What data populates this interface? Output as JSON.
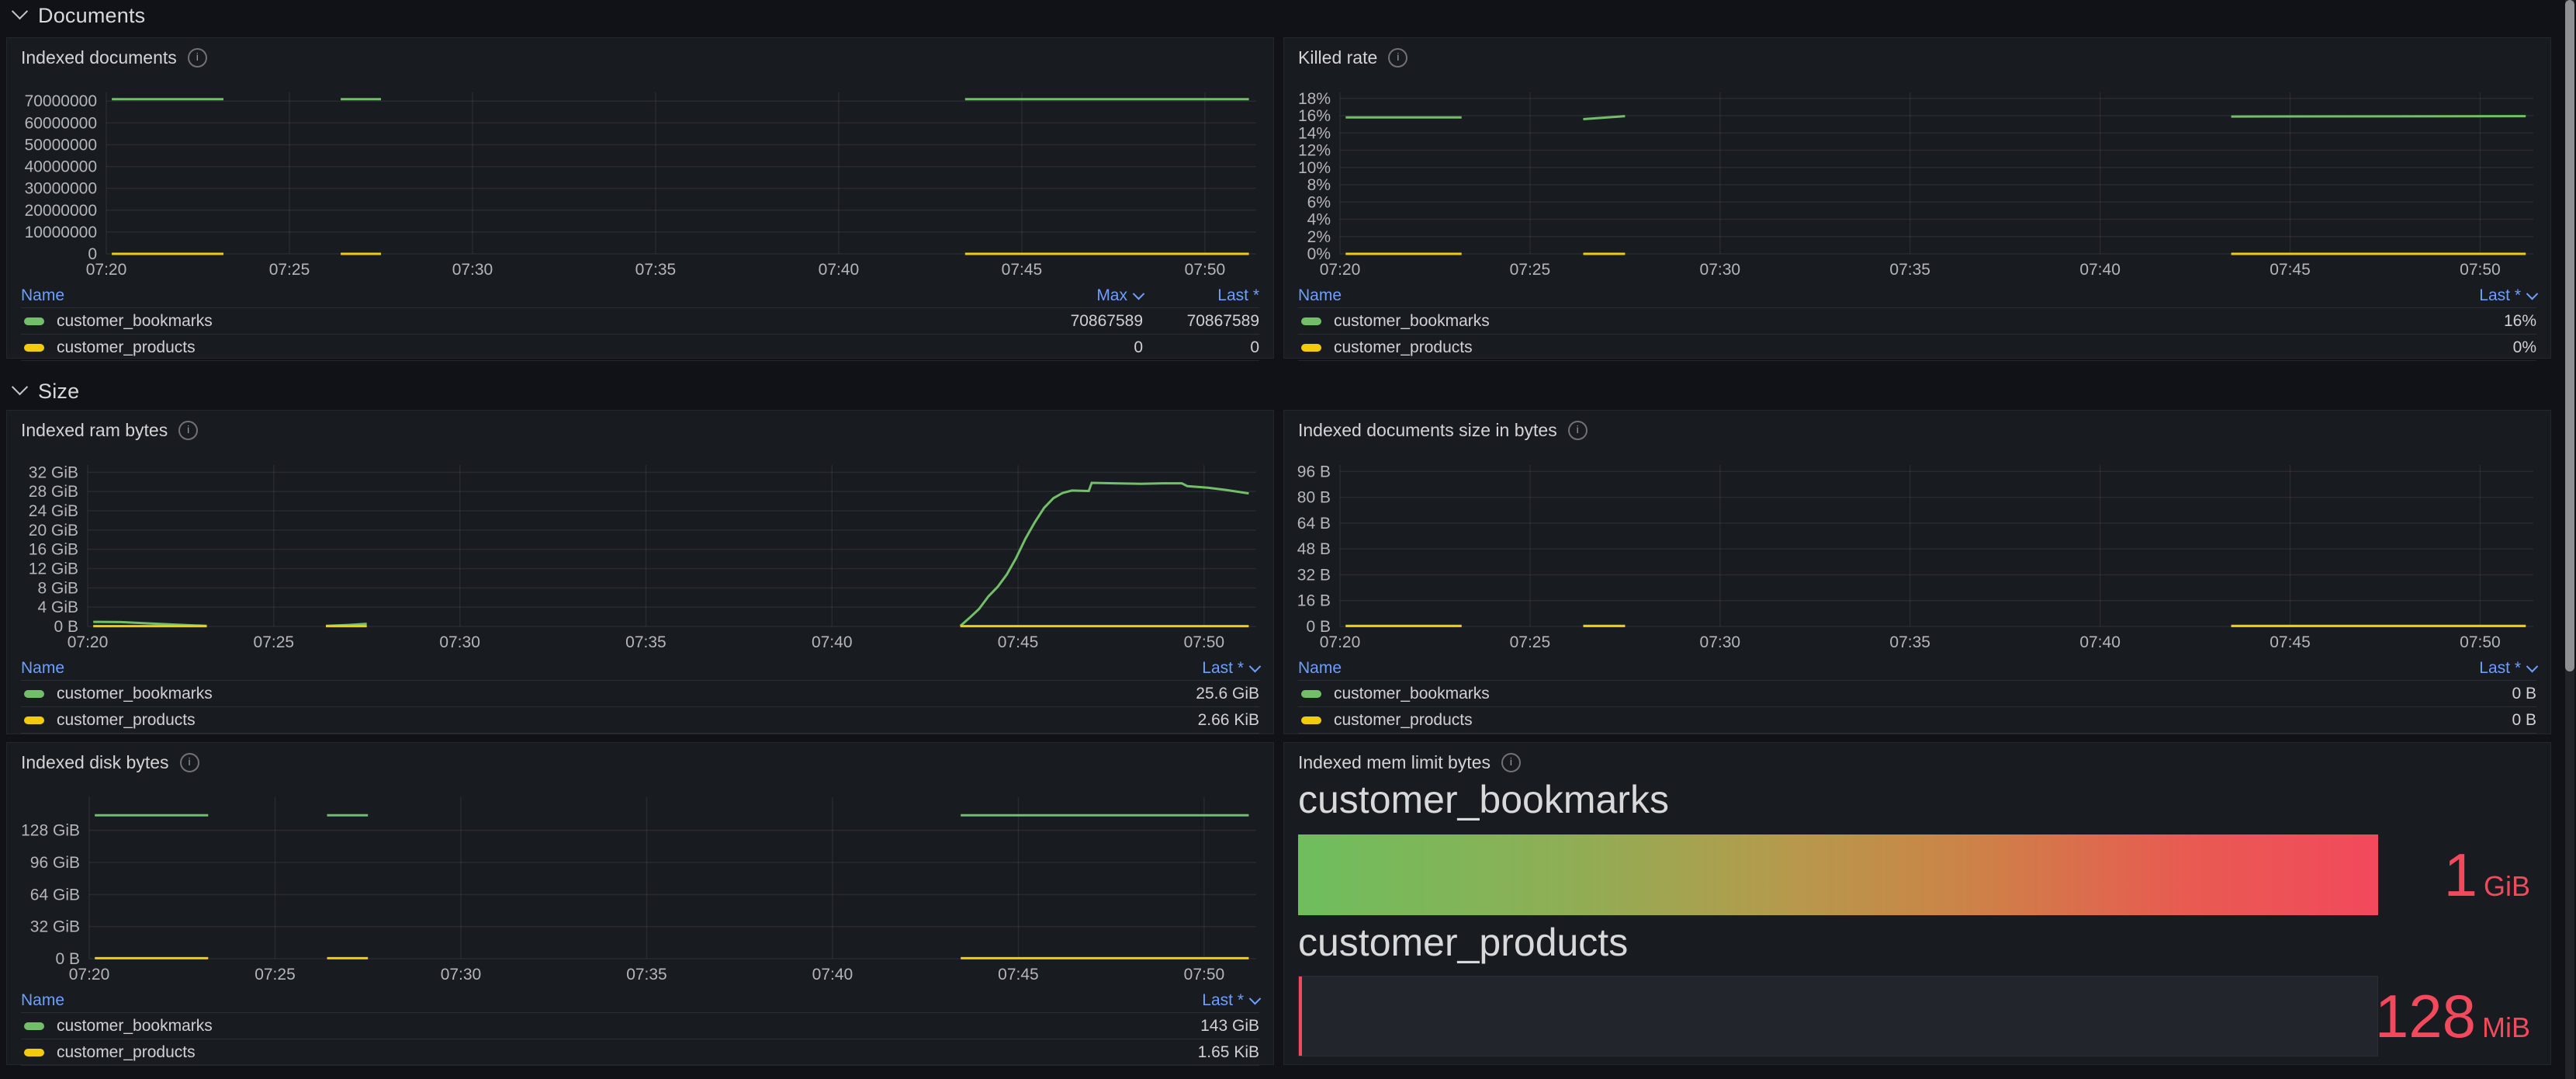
{
  "colors": {
    "green": "#73bf69",
    "yellow": "#f2cc0c",
    "blue_header": "#6e9fff",
    "red_value": "#f2495c",
    "panel_bg": "#181b1f",
    "page_bg": "#111217",
    "gauge_gradient": [
      "#6ebe5e",
      "#b59a4c",
      "#f2495c"
    ]
  },
  "rows": [
    {
      "label": "Documents"
    },
    {
      "label": "Size"
    }
  ],
  "chart_data": [
    {
      "type": "line",
      "title": "Indexed documents",
      "xlabel": "",
      "ylabel": "",
      "xlim": [
        0,
        31.4
      ],
      "ylim": [
        0,
        74000000
      ],
      "x_ticks": [
        [
          0,
          "07:20"
        ],
        [
          5,
          "07:25"
        ],
        [
          10,
          "07:30"
        ],
        [
          15,
          "07:35"
        ],
        [
          20,
          "07:40"
        ],
        [
          25,
          "07:45"
        ],
        [
          30,
          "07:50"
        ]
      ],
      "y_ticks": [
        [
          0,
          "0"
        ],
        [
          10000000,
          "10000000"
        ],
        [
          20000000,
          "20000000"
        ],
        [
          30000000,
          "30000000"
        ],
        [
          40000000,
          "40000000"
        ],
        [
          50000000,
          "50000000"
        ],
        [
          60000000,
          "60000000"
        ],
        [
          70000000,
          "70000000"
        ]
      ],
      "series": [
        {
          "name": "customer_bookmarks",
          "color": "green",
          "segments": [
            [
              [
                0.15,
                70867589
              ],
              [
                3.2,
                70867589
              ]
            ],
            [
              [
                6.4,
                70867589
              ],
              [
                7.5,
                70867589
              ]
            ],
            [
              [
                23.45,
                70867589
              ],
              [
                31.2,
                70867589
              ]
            ]
          ]
        },
        {
          "name": "customer_products",
          "color": "yellow",
          "segments": [
            [
              [
                0.15,
                0
              ],
              [
                3.2,
                0
              ]
            ],
            [
              [
                6.4,
                0
              ],
              [
                7.5,
                0
              ]
            ],
            [
              [
                23.45,
                0
              ],
              [
                31.2,
                0
              ]
            ]
          ]
        }
      ],
      "legend": {
        "name_header": "Name",
        "value_columns": [
          {
            "label": "Max",
            "sorted": true
          },
          {
            "label": "Last *",
            "sorted": false
          }
        ],
        "rows": [
          {
            "name": "customer_bookmarks",
            "color": "green",
            "values": [
              "70867589",
              "70867589"
            ]
          },
          {
            "name": "customer_products",
            "color": "yellow",
            "values": [
              "0",
              "0"
            ]
          }
        ]
      }
    },
    {
      "type": "line",
      "title": "Killed rate",
      "xlabel": "",
      "ylabel": "",
      "xlim": [
        0,
        31.4
      ],
      "ylim": [
        0,
        18.7
      ],
      "x_ticks": [
        [
          0,
          "07:20"
        ],
        [
          5,
          "07:25"
        ],
        [
          10,
          "07:30"
        ],
        [
          15,
          "07:35"
        ],
        [
          20,
          "07:40"
        ],
        [
          25,
          "07:45"
        ],
        [
          30,
          "07:50"
        ]
      ],
      "y_ticks": [
        [
          0,
          "0%"
        ],
        [
          2,
          "2%"
        ],
        [
          4,
          "4%"
        ],
        [
          6,
          "6%"
        ],
        [
          8,
          "8%"
        ],
        [
          10,
          "10%"
        ],
        [
          12,
          "12%"
        ],
        [
          14,
          "14%"
        ],
        [
          16,
          "16%"
        ],
        [
          18,
          "18%"
        ]
      ],
      "series": [
        {
          "name": "customer_bookmarks",
          "color": "green",
          "segments": [
            [
              [
                0.15,
                15.8
              ],
              [
                3.2,
                15.8
              ]
            ],
            [
              [
                6.4,
                15.6
              ],
              [
                7.5,
                15.95
              ]
            ],
            [
              [
                23.45,
                15.9
              ],
              [
                31.2,
                15.95
              ]
            ]
          ]
        },
        {
          "name": "customer_products",
          "color": "yellow",
          "segments": [
            [
              [
                0.15,
                0
              ],
              [
                3.2,
                0
              ]
            ],
            [
              [
                6.4,
                0
              ],
              [
                7.5,
                0
              ]
            ],
            [
              [
                23.45,
                0
              ],
              [
                31.2,
                0
              ]
            ]
          ]
        }
      ],
      "legend": {
        "name_header": "Name",
        "value_columns": [
          {
            "label": "Last *",
            "sorted": true
          }
        ],
        "rows": [
          {
            "name": "customer_bookmarks",
            "color": "green",
            "values": [
              "16%"
            ]
          },
          {
            "name": "customer_products",
            "color": "yellow",
            "values": [
              "0%"
            ]
          }
        ]
      }
    },
    {
      "type": "line",
      "title": "Indexed ram bytes",
      "xlabel": "",
      "ylabel": "",
      "xlim": [
        0,
        31.4
      ],
      "ylim": [
        0,
        33.5
      ],
      "x_ticks": [
        [
          0,
          "07:20"
        ],
        [
          5,
          "07:25"
        ],
        [
          10,
          "07:30"
        ],
        [
          15,
          "07:35"
        ],
        [
          20,
          "07:40"
        ],
        [
          25,
          "07:45"
        ],
        [
          30,
          "07:50"
        ]
      ],
      "y_ticks": [
        [
          0,
          "0 B"
        ],
        [
          4,
          "4 GiB"
        ],
        [
          8,
          "8 GiB"
        ],
        [
          12,
          "12 GiB"
        ],
        [
          16,
          "16 GiB"
        ],
        [
          20,
          "20 GiB"
        ],
        [
          24,
          "24 GiB"
        ],
        [
          28,
          "28 GiB"
        ],
        [
          32,
          "32 GiB"
        ]
      ],
      "series": [
        {
          "name": "customer_bookmarks",
          "color": "green",
          "segments": [
            [
              [
                0.15,
                0.95
              ],
              [
                0.9,
                0.9
              ],
              [
                1.6,
                0.65
              ],
              [
                2.4,
                0.35
              ],
              [
                3.2,
                0.12
              ]
            ],
            [
              [
                6.4,
                0.12
              ],
              [
                7.0,
                0.3
              ],
              [
                7.5,
                0.55
              ]
            ],
            [
              [
                23.45,
                0.1
              ],
              [
                23.7,
                1.8
              ],
              [
                23.95,
                3.6
              ],
              [
                24.2,
                6.2
              ],
              [
                24.45,
                8.2
              ],
              [
                24.7,
                10.8
              ],
              [
                24.95,
                14.2
              ],
              [
                25.2,
                18.2
              ],
              [
                25.45,
                21.6
              ],
              [
                25.7,
                24.6
              ],
              [
                25.95,
                26.6
              ],
              [
                26.2,
                27.7
              ],
              [
                26.45,
                28.2
              ],
              [
                26.9,
                28.1
              ],
              [
                26.98,
                29.8
              ],
              [
                27.6,
                29.7
              ],
              [
                28.3,
                29.6
              ],
              [
                28.9,
                29.7
              ],
              [
                29.4,
                29.7
              ],
              [
                29.55,
                29.1
              ],
              [
                30.1,
                28.8
              ],
              [
                30.6,
                28.3
              ],
              [
                31.2,
                27.6
              ]
            ]
          ]
        },
        {
          "name": "customer_products",
          "color": "yellow",
          "segments": [
            [
              [
                0.15,
                0.06
              ],
              [
                3.2,
                0.06
              ]
            ],
            [
              [
                6.4,
                0.06
              ],
              [
                7.5,
                0.06
              ]
            ],
            [
              [
                23.45,
                0.06
              ],
              [
                31.2,
                0.06
              ]
            ]
          ]
        }
      ],
      "legend": {
        "name_header": "Name",
        "value_columns": [
          {
            "label": "Last *",
            "sorted": true
          }
        ],
        "rows": [
          {
            "name": "customer_bookmarks",
            "color": "green",
            "values": [
              "25.6 GiB"
            ]
          },
          {
            "name": "customer_products",
            "color": "yellow",
            "values": [
              "2.66 KiB"
            ]
          }
        ]
      }
    },
    {
      "type": "line",
      "title": "Indexed documents size in bytes",
      "xlabel": "",
      "ylabel": "",
      "xlim": [
        0,
        31.4
      ],
      "ylim": [
        0,
        100
      ],
      "x_ticks": [
        [
          0,
          "07:20"
        ],
        [
          5,
          "07:25"
        ],
        [
          10,
          "07:30"
        ],
        [
          15,
          "07:35"
        ],
        [
          20,
          "07:40"
        ],
        [
          25,
          "07:45"
        ],
        [
          30,
          "07:50"
        ]
      ],
      "y_ticks": [
        [
          0,
          "0 B"
        ],
        [
          16,
          "16 B"
        ],
        [
          32,
          "32 B"
        ],
        [
          48,
          "48 B"
        ],
        [
          64,
          "64 B"
        ],
        [
          80,
          "80 B"
        ],
        [
          96,
          "96 B"
        ]
      ],
      "series": [
        {
          "name": "customer_bookmarks",
          "color": "green",
          "segments": [
            [
              [
                0.15,
                0.3
              ],
              [
                3.2,
                0.3
              ]
            ],
            [
              [
                6.4,
                0.3
              ],
              [
                7.5,
                0.3
              ]
            ],
            [
              [
                23.45,
                0.3
              ],
              [
                31.2,
                0.3
              ]
            ]
          ]
        },
        {
          "name": "customer_products",
          "color": "yellow",
          "segments": [
            [
              [
                0.15,
                0.3
              ],
              [
                3.2,
                0.3
              ]
            ],
            [
              [
                6.4,
                0.3
              ],
              [
                7.5,
                0.3
              ]
            ],
            [
              [
                23.45,
                0.3
              ],
              [
                31.2,
                0.3
              ]
            ]
          ]
        }
      ],
      "legend": {
        "name_header": "Name",
        "value_columns": [
          {
            "label": "Last *",
            "sorted": true
          }
        ],
        "rows": [
          {
            "name": "customer_bookmarks",
            "color": "green",
            "values": [
              "0 B"
            ]
          },
          {
            "name": "customer_products",
            "color": "yellow",
            "values": [
              "0 B"
            ]
          }
        ]
      }
    },
    {
      "type": "line",
      "title": "Indexed disk bytes",
      "xlabel": "",
      "ylabel": "",
      "xlim": [
        0,
        31.4
      ],
      "ylim": [
        0,
        161
      ],
      "x_ticks": [
        [
          0,
          "07:20"
        ],
        [
          5,
          "07:25"
        ],
        [
          10,
          "07:30"
        ],
        [
          15,
          "07:35"
        ],
        [
          20,
          "07:40"
        ],
        [
          25,
          "07:45"
        ],
        [
          30,
          "07:50"
        ]
      ],
      "y_ticks": [
        [
          0,
          "0 B"
        ],
        [
          32,
          "32 GiB"
        ],
        [
          64,
          "64 GiB"
        ],
        [
          96,
          "96 GiB"
        ],
        [
          128,
          "128 GiB"
        ]
      ],
      "series": [
        {
          "name": "customer_bookmarks",
          "color": "green",
          "segments": [
            [
              [
                0.15,
                143
              ],
              [
                3.2,
                143
              ]
            ],
            [
              [
                6.4,
                143
              ],
              [
                7.5,
                143
              ]
            ],
            [
              [
                23.45,
                143
              ],
              [
                31.2,
                143
              ]
            ]
          ]
        },
        {
          "name": "customer_products",
          "color": "yellow",
          "segments": [
            [
              [
                0.15,
                0.5
              ],
              [
                3.2,
                0.5
              ]
            ],
            [
              [
                6.4,
                0.5
              ],
              [
                7.5,
                0.5
              ]
            ],
            [
              [
                23.45,
                0.5
              ],
              [
                31.2,
                0.5
              ]
            ]
          ]
        }
      ],
      "legend": {
        "name_header": "Name",
        "value_columns": [
          {
            "label": "Last *",
            "sorted": true
          }
        ],
        "rows": [
          {
            "name": "customer_bookmarks",
            "color": "green",
            "values": [
              "143 GiB"
            ]
          },
          {
            "name": "customer_products",
            "color": "yellow",
            "values": [
              "1.65 KiB"
            ]
          }
        ]
      }
    },
    {
      "type": "bargauge",
      "title": "Indexed mem limit bytes",
      "items": [
        {
          "name": "customer_bookmarks",
          "value": "1",
          "unit": "GiB",
          "fill": "gradient",
          "fill_percent": 100
        },
        {
          "name": "customer_products",
          "value": "128",
          "unit": "MiB",
          "fill": "empty",
          "fill_percent": 0.3
        }
      ]
    }
  ]
}
